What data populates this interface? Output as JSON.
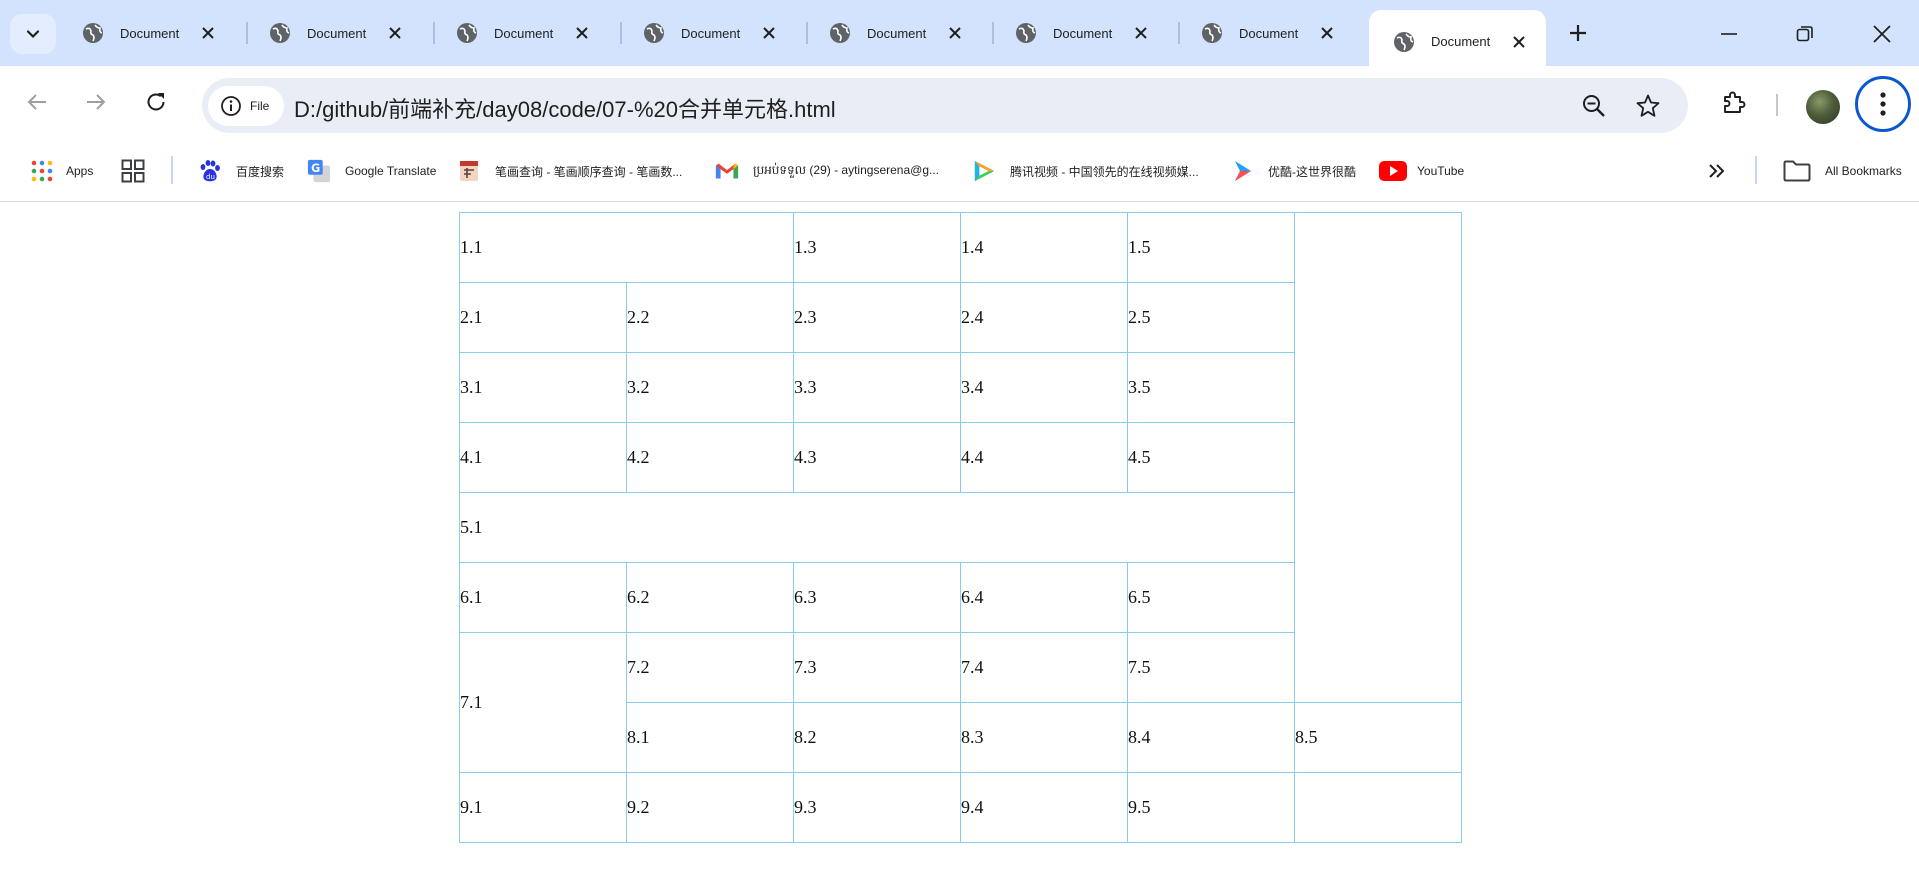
{
  "tabs": [
    {
      "title": "Document"
    },
    {
      "title": "Document"
    },
    {
      "title": "Document"
    },
    {
      "title": "Document"
    },
    {
      "title": "Document"
    },
    {
      "title": "Document"
    },
    {
      "title": "Document"
    },
    {
      "title": "Document",
      "active": true
    }
  ],
  "toolbar": {
    "site_chip": "File",
    "url": "D:/github/前端补充/day08/code/07-%20合并单元格.html"
  },
  "bookmarks": [
    {
      "label": "Apps",
      "icon": "apps-grid-icon"
    },
    {
      "label": "",
      "icon": "tab-groups-icon"
    },
    {
      "label": "百度搜索",
      "icon": "baidu-icon"
    },
    {
      "label": "Google Translate",
      "icon": "google-translate-icon"
    },
    {
      "label": "笔画查询 - 笔画顺序查询 - 笔画数...",
      "icon": "stroke-lookup-icon"
    },
    {
      "label": "ប្រអប់ទទួល (29) - aytingserena@g...",
      "icon": "gmail-icon"
    },
    {
      "label": "腾讯视频 - 中国领先的在线视频媒...",
      "icon": "tencent-video-icon"
    },
    {
      "label": "优酷-这世界很酷",
      "icon": "youku-icon"
    },
    {
      "label": "YouTube",
      "icon": "youtube-icon"
    },
    {
      "label": "All Bookmarks",
      "icon": "folder-icon"
    }
  ],
  "table": {
    "r1": [
      "1.1",
      "1.3",
      "1.4",
      "1.5",
      ""
    ],
    "r2": [
      "2.1",
      "2.2",
      "2.3",
      "2.4",
      "2.5"
    ],
    "r3": [
      "3.1",
      "3.2",
      "3.3",
      "3.4",
      "3.5"
    ],
    "r4": [
      "4.1",
      "4.2",
      "4.3",
      "4.4",
      "4.5"
    ],
    "r5": [
      "5.1"
    ],
    "r6": [
      "6.1",
      "6.2",
      "6.3",
      "6.4",
      "6.5"
    ],
    "r7": [
      "7.1",
      "7.2",
      "7.3",
      "7.4",
      "7.5"
    ],
    "r8": [
      "8.1",
      "8.2",
      "8.3",
      "8.4",
      "8.5"
    ],
    "r9": [
      "9.1",
      "9.2",
      "9.3",
      "9.4",
      "9.5",
      ""
    ]
  },
  "colors": {
    "tabstrip": "#d3e3fd",
    "omnibox": "#e9eef6",
    "table_border": "#87ceeb",
    "focus_ring": "#0b57d0"
  }
}
